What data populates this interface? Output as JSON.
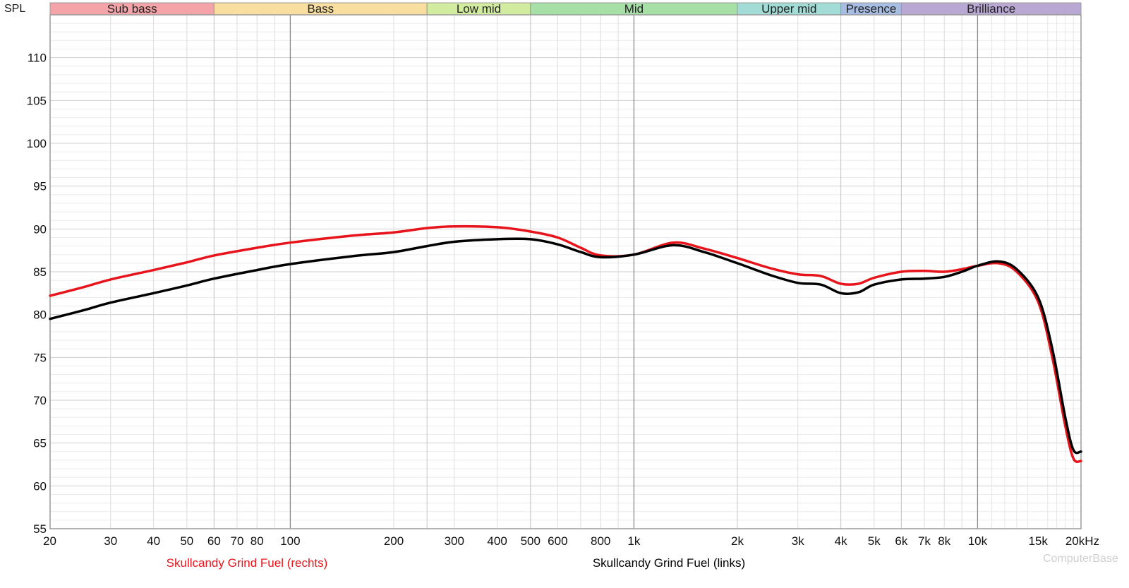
{
  "chart_data": {
    "type": "line",
    "ylabel": "SPL",
    "x_unit": "kHz",
    "x_scale": "log",
    "xlim": [
      20,
      20000
    ],
    "ylim": [
      55,
      115
    ],
    "grid": true,
    "y_ticks": [
      55,
      60,
      65,
      70,
      75,
      80,
      85,
      90,
      95,
      100,
      105,
      110
    ],
    "x_ticks": [
      {
        "value": 20,
        "label": "20"
      },
      {
        "value": 30,
        "label": "30"
      },
      {
        "value": 40,
        "label": "40"
      },
      {
        "value": 50,
        "label": "50"
      },
      {
        "value": 60,
        "label": "60"
      },
      {
        "value": 70,
        "label": "70"
      },
      {
        "value": 80,
        "label": "80"
      },
      {
        "value": 100,
        "label": "100"
      },
      {
        "value": 200,
        "label": "200"
      },
      {
        "value": 300,
        "label": "300"
      },
      {
        "value": 400,
        "label": "400"
      },
      {
        "value": 500,
        "label": "500"
      },
      {
        "value": 600,
        "label": "600"
      },
      {
        "value": 800,
        "label": "800"
      },
      {
        "value": 1000,
        "label": "1k"
      },
      {
        "value": 2000,
        "label": "2k"
      },
      {
        "value": 3000,
        "label": "3k"
      },
      {
        "value": 4000,
        "label": "4k"
      },
      {
        "value": 5000,
        "label": "5k"
      },
      {
        "value": 6000,
        "label": "6k"
      },
      {
        "value": 7000,
        "label": "7k"
      },
      {
        "value": 8000,
        "label": "8k"
      },
      {
        "value": 10000,
        "label": "10k"
      },
      {
        "value": 15000,
        "label": "15k"
      },
      {
        "value": 20000,
        "label": "20kHz"
      }
    ],
    "bands": [
      {
        "name": "Sub bass",
        "from": 20,
        "to": 60,
        "color": "#f4a3a8"
      },
      {
        "name": "Bass",
        "from": 60,
        "to": 250,
        "color": "#f8dfa0"
      },
      {
        "name": "Low mid",
        "from": 250,
        "to": 500,
        "color": "#d2ec9f"
      },
      {
        "name": "Mid",
        "from": 500,
        "to": 2000,
        "color": "#a6e0a6"
      },
      {
        "name": "Upper mid",
        "from": 2000,
        "to": 4000,
        "color": "#a3dcd6"
      },
      {
        "name": "Presence",
        "from": 4000,
        "to": 6000,
        "color": "#a7bde3"
      },
      {
        "name": "Brilliance",
        "from": 6000,
        "to": 20000,
        "color": "#b9a8d4"
      }
    ],
    "series": [
      {
        "name": "Skullcandy Grind Fuel (rechts)",
        "color": "#e8141b",
        "points": [
          [
            20,
            82.2
          ],
          [
            25,
            83.2
          ],
          [
            30,
            84.1
          ],
          [
            40,
            85.2
          ],
          [
            50,
            86.1
          ],
          [
            60,
            86.9
          ],
          [
            80,
            87.8
          ],
          [
            100,
            88.4
          ],
          [
            150,
            89.2
          ],
          [
            200,
            89.6
          ],
          [
            250,
            90.1
          ],
          [
            300,
            90.3
          ],
          [
            400,
            90.2
          ],
          [
            500,
            89.7
          ],
          [
            600,
            89.0
          ],
          [
            700,
            87.8
          ],
          [
            800,
            86.9
          ],
          [
            1000,
            87.0
          ],
          [
            1300,
            88.4
          ],
          [
            1600,
            87.7
          ],
          [
            2000,
            86.6
          ],
          [
            2500,
            85.4
          ],
          [
            3000,
            84.7
          ],
          [
            3500,
            84.5
          ],
          [
            4000,
            83.6
          ],
          [
            4500,
            83.6
          ],
          [
            5000,
            84.3
          ],
          [
            6000,
            85.0
          ],
          [
            7000,
            85.1
          ],
          [
            8000,
            85.0
          ],
          [
            9000,
            85.3
          ],
          [
            10000,
            85.7
          ],
          [
            11500,
            86.0
          ],
          [
            13000,
            85.0
          ],
          [
            15000,
            81.5
          ],
          [
            16500,
            75.0
          ],
          [
            18000,
            67.0
          ],
          [
            19000,
            63.2
          ],
          [
            20000,
            62.9
          ]
        ]
      },
      {
        "name": "Skullcandy Grind Fuel (links)",
        "color": "#000000",
        "points": [
          [
            20,
            79.5
          ],
          [
            25,
            80.5
          ],
          [
            30,
            81.4
          ],
          [
            40,
            82.5
          ],
          [
            50,
            83.4
          ],
          [
            60,
            84.2
          ],
          [
            80,
            85.2
          ],
          [
            100,
            85.9
          ],
          [
            150,
            86.8
          ],
          [
            200,
            87.3
          ],
          [
            250,
            88.0
          ],
          [
            300,
            88.5
          ],
          [
            400,
            88.8
          ],
          [
            500,
            88.8
          ],
          [
            600,
            88.2
          ],
          [
            700,
            87.3
          ],
          [
            800,
            86.7
          ],
          [
            1000,
            87.0
          ],
          [
            1300,
            88.1
          ],
          [
            1600,
            87.3
          ],
          [
            2000,
            86.0
          ],
          [
            2500,
            84.6
          ],
          [
            3000,
            83.7
          ],
          [
            3500,
            83.5
          ],
          [
            4000,
            82.5
          ],
          [
            4500,
            82.6
          ],
          [
            5000,
            83.5
          ],
          [
            6000,
            84.1
          ],
          [
            7000,
            84.2
          ],
          [
            8000,
            84.4
          ],
          [
            9000,
            85.0
          ],
          [
            10000,
            85.7
          ],
          [
            11500,
            86.2
          ],
          [
            13000,
            85.3
          ],
          [
            15000,
            82.0
          ],
          [
            16500,
            76.0
          ],
          [
            18000,
            68.0
          ],
          [
            19000,
            64.2
          ],
          [
            20000,
            64.0
          ]
        ]
      }
    ],
    "watermark": "ComputerBase"
  }
}
